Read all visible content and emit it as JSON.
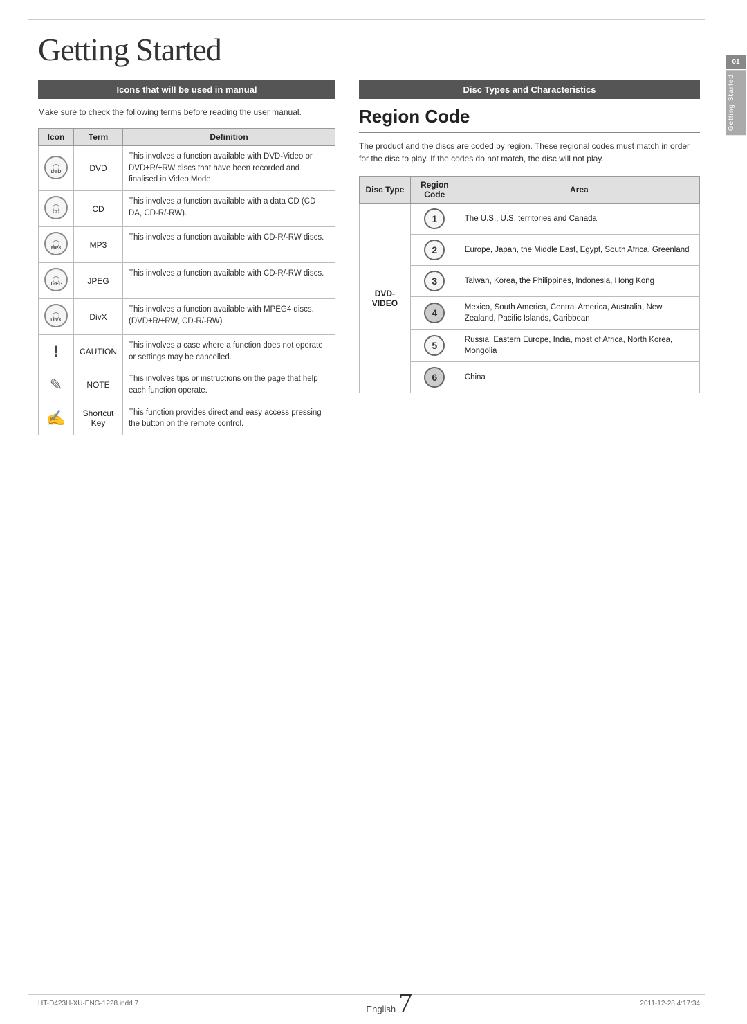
{
  "page": {
    "title": "Getting Started",
    "language": "English",
    "page_number": "7",
    "footer_left": "HT-D423H-XU-ENG-1228.indd  7",
    "footer_right": "2011-12-28   4:17:34"
  },
  "sidebar": {
    "number": "01",
    "label": "Getting Started"
  },
  "left_section": {
    "header": "Icons that will be used in manual",
    "intro": "Make sure to check the following terms before reading the user manual.",
    "table": {
      "headers": [
        "Icon",
        "Term",
        "Definition"
      ],
      "rows": [
        {
          "icon_label": "DVD",
          "term": "DVD",
          "definition": "This involves a function available with DVD-Video or DVD±R/±RW discs that have been recorded and finalised in Video Mode."
        },
        {
          "icon_label": "CD",
          "term": "CD",
          "definition": "This involves a function available with a data CD (CD DA, CD-R/-RW)."
        },
        {
          "icon_label": "MP3",
          "term": "MP3",
          "definition": "This involves a function available with CD-R/-RW discs."
        },
        {
          "icon_label": "JPEG",
          "term": "JPEG",
          "definition": "This involves a function available with CD-R/-RW discs."
        },
        {
          "icon_label": "DivX",
          "term": "DivX",
          "definition": "This involves a function available with MPEG4 discs. (DVD±R/±RW, CD-R/-RW)"
        },
        {
          "icon_label": "!",
          "term": "CAUTION",
          "definition": "This involves a case where a function does not operate or settings may be cancelled."
        },
        {
          "icon_label": "NOTE",
          "term": "NOTE",
          "definition": "This involves tips or instructions on the page that help each function operate."
        },
        {
          "icon_label": "SK",
          "term": "Shortcut Key",
          "definition": "This function provides direct and easy access pressing the button on the remote control."
        }
      ]
    }
  },
  "right_section": {
    "header": "Disc Types and Characteristics",
    "region_code": {
      "title": "Region Code",
      "description": "The product and the discs are coded by region. These regional codes must match in order for the disc to play. If the codes do not match, the disc will not play.",
      "table": {
        "headers": [
          "Disc Type",
          "Region Code",
          "Area"
        ],
        "rows": [
          {
            "disc_type": "DVD-VIDEO",
            "code": "1",
            "area": "The U.S., U.S. territories and Canada"
          },
          {
            "disc_type": "",
            "code": "2",
            "area": "Europe, Japan, the Middle East, Egypt, South Africa, Greenland"
          },
          {
            "disc_type": "",
            "code": "3",
            "area": "Taiwan, Korea, the Philippines, Indonesia, Hong Kong"
          },
          {
            "disc_type": "",
            "code": "4",
            "area": "Mexico, South America, Central America, Australia, New Zealand, Pacific Islands, Caribbean"
          },
          {
            "disc_type": "",
            "code": "5",
            "area": "Russia, Eastern Europe, India, most of Africa, North Korea, Mongolia"
          },
          {
            "disc_type": "",
            "code": "6",
            "area": "China"
          }
        ]
      }
    }
  }
}
